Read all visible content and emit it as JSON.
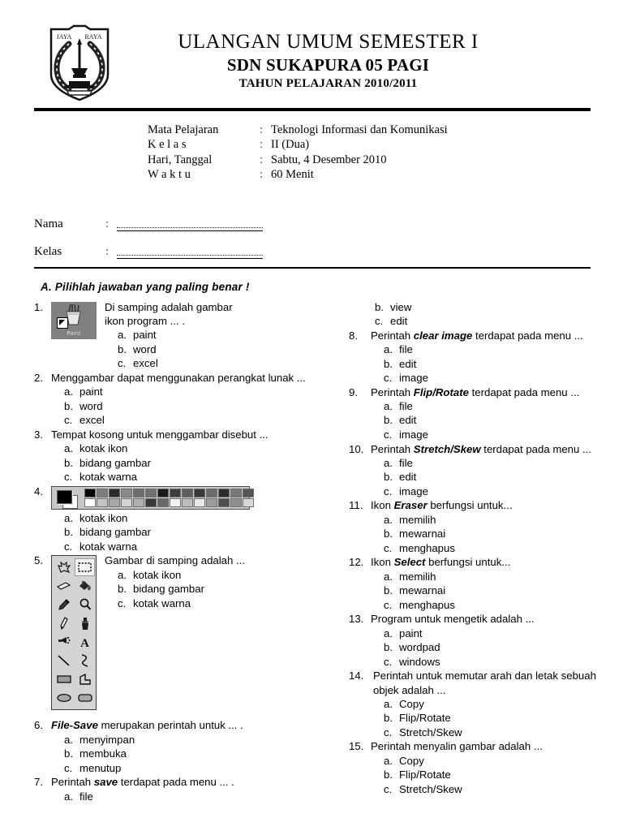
{
  "header": {
    "logo_text_left": "JAYA",
    "logo_text_right": "RAYA",
    "title_line1": "ULANGAN UMUM SEMESTER I",
    "title_line2": "SDN SUKAPURA 05 PAGI",
    "title_line3": "TAHUN PELAJARAN 2010/2011"
  },
  "info": [
    {
      "label": "Mata Pelajaran",
      "colon": ":",
      "value": "Teknologi Informasi dan Komunikasi"
    },
    {
      "label": "K e l a s",
      "colon": ":",
      "value": "II (Dua)"
    },
    {
      "label": "Hari, Tanggal",
      "colon": ":",
      "value": "Sabtu, 4 Desember 2010"
    },
    {
      "label": "W a k t u",
      "colon": ":",
      "value": "60 Menit"
    }
  ],
  "fields": [
    {
      "label": "Nama",
      "colon": ":",
      "value": ""
    },
    {
      "label": "Kelas",
      "colon": ":",
      "value": ""
    }
  ],
  "section_a": {
    "heading": "A. Pilihlah jawaban yang paling benar !"
  },
  "questions": {
    "q1": {
      "num": "1.",
      "figure": "paint-desktop-icon",
      "icon_label": "Paint",
      "text_line1": "Di samping adalah gambar",
      "text_line2": "ikon program ... .",
      "options": [
        {
          "key": "a.",
          "val": "paint"
        },
        {
          "key": "b.",
          "val": "word"
        },
        {
          "key": "c.",
          "val": "excel"
        }
      ]
    },
    "q2": {
      "num": "2.",
      "text": "Menggambar dapat menggunakan perangkat lunak ...",
      "options": [
        {
          "key": "a.",
          "val": "paint"
        },
        {
          "key": "b.",
          "val": "word"
        },
        {
          "key": "c.",
          "val": "excel"
        }
      ]
    },
    "q3": {
      "num": "3.",
      "text": "Tempat kosong untuk menggambar disebut ...",
      "options": [
        {
          "key": "a.",
          "val": "kotak ikon"
        },
        {
          "key": "b.",
          "val": "bidang gambar"
        },
        {
          "key": "c.",
          "val": "kotak warna"
        }
      ]
    },
    "q4": {
      "num": "4.",
      "figure": "paint-color-box",
      "options": [
        {
          "key": "a.",
          "val": "kotak ikon"
        },
        {
          "key": "b.",
          "val": "bidang gambar"
        },
        {
          "key": "c.",
          "val": "kotak warna"
        }
      ]
    },
    "q5": {
      "num": "5.",
      "figure": "paint-toolbox",
      "text": "Gambar di samping adalah ...",
      "options": [
        {
          "key": "a.",
          "val": "kotak ikon"
        },
        {
          "key": "b.",
          "val": "bidang gambar"
        },
        {
          "key": "c.",
          "val": "kotak warna"
        }
      ]
    },
    "q6": {
      "num": "6.",
      "bold": "File-Save",
      "text_after": " merupakan perintah untuk ... .",
      "options": [
        {
          "key": "a.",
          "val": "menyimpan"
        },
        {
          "key": "b.",
          "val": "membuka"
        },
        {
          "key": "c.",
          "val": "menutup"
        }
      ]
    },
    "q7": {
      "num": "7.",
      "text_before": "Perintah ",
      "bold": "save",
      "text_after": " terdapat pada menu ... .",
      "options": [
        {
          "key": "a.",
          "val": "file"
        },
        {
          "key": "b.",
          "val": "view"
        },
        {
          "key": "c.",
          "val": "edit"
        }
      ]
    },
    "q8": {
      "num": "8.",
      "text_before": "Perintah ",
      "bold": "clear image",
      "text_after": " terdapat pada menu ...",
      "options": [
        {
          "key": "a.",
          "val": "file"
        },
        {
          "key": "b.",
          "val": "edit"
        },
        {
          "key": "c.",
          "val": "image"
        }
      ]
    },
    "q9": {
      "num": "9.",
      "text_before": "Perintah ",
      "bold": "Flip/Rotate",
      "text_after": " terdapat pada menu ...",
      "options": [
        {
          "key": "a.",
          "val": "file"
        },
        {
          "key": "b.",
          "val": "edit"
        },
        {
          "key": "c.",
          "val": "image"
        }
      ]
    },
    "q10": {
      "num": "10.",
      "text_before": "Perintah ",
      "bold": "Stretch/Skew",
      "text_after": " terdapat pada menu ...",
      "options": [
        {
          "key": "a.",
          "val": "file"
        },
        {
          "key": "b.",
          "val": "edit"
        },
        {
          "key": "c.",
          "val": "image"
        }
      ]
    },
    "q11": {
      "num": "11.",
      "text_before": "Ikon ",
      "bold": "Eraser",
      "text_after": "  berfungsi untuk...",
      "options": [
        {
          "key": "a.",
          "val": "memilih"
        },
        {
          "key": "b.",
          "val": "mewarnai"
        },
        {
          "key": "c.",
          "val": "menghapus"
        }
      ]
    },
    "q12": {
      "num": "12.",
      "text_before": "Ikon ",
      "bold": "Select",
      "text_after": "  berfungsi untuk...",
      "options": [
        {
          "key": "a.",
          "val": "memilih"
        },
        {
          "key": "b.",
          "val": "mewarnai"
        },
        {
          "key": "c.",
          "val": "menghapus"
        }
      ]
    },
    "q13": {
      "num": "13.",
      "text": "Program untuk mengetik adalah ...",
      "options": [
        {
          "key": "a.",
          "val": "paint"
        },
        {
          "key": "b.",
          "val": "wordpad"
        },
        {
          "key": "c.",
          "val": "windows"
        }
      ]
    },
    "q14": {
      "num": "14.",
      "text": "Perintah untuk memutar arah dan letak sebuah objek  adalah ...",
      "options": [
        {
          "key": "a.",
          "val": "Copy"
        },
        {
          "key": "b.",
          "val": "Flip/Rotate"
        },
        {
          "key": "c.",
          "val": " Stretch/Skew"
        }
      ]
    },
    "q15": {
      "num": "15.",
      "text": "Perintah menyalin gambar adalah ...",
      "options": [
        {
          "key": "a.",
          "val": "Copy"
        },
        {
          "key": "b.",
          "val": "Flip/Rotate"
        },
        {
          "key": "c.",
          "val": " Stretch/Skew"
        }
      ]
    }
  },
  "palette": {
    "row1": [
      "#000000",
      "#7d7d7d",
      "#2b2b2b",
      "#8a8a8a",
      "#6e6e6e",
      "#707070",
      "#1a1a1a",
      "#3d3d3d",
      "#5c5c5c",
      "#383838",
      "#6b6b6b",
      "#2e2e2e",
      "#787878",
      "#555555"
    ],
    "row2": [
      "#ffffff",
      "#c4c4c4",
      "#a8a8a8",
      "#d4d4d4",
      "#b0b0b0",
      "#3a3a3a",
      "#6a6a6a",
      "#f2f2f2",
      "#bdbdbd",
      "#e8e8e8",
      "#9c9c9c",
      "#4e4e4e",
      "#8f8f8f",
      "#d8d8d8"
    ]
  },
  "toolbox": {
    "tools": [
      {
        "name": "free-form-select-icon",
        "selected": false
      },
      {
        "name": "rectangular-select-icon",
        "selected": true
      },
      {
        "name": "eraser-icon",
        "selected": false
      },
      {
        "name": "fill-with-color-icon",
        "selected": false
      },
      {
        "name": "pick-color-icon",
        "selected": false
      },
      {
        "name": "magnifier-icon",
        "selected": false
      },
      {
        "name": "pencil-icon",
        "selected": false
      },
      {
        "name": "brush-icon",
        "selected": false
      },
      {
        "name": "airbrush-icon",
        "selected": false
      },
      {
        "name": "text-tool-icon",
        "selected": false
      },
      {
        "name": "line-icon",
        "selected": false
      },
      {
        "name": "curve-icon",
        "selected": false
      },
      {
        "name": "rectangle-icon",
        "selected": false
      },
      {
        "name": "polygon-icon",
        "selected": false
      },
      {
        "name": "ellipse-icon",
        "selected": false
      },
      {
        "name": "rounded-rectangle-icon",
        "selected": false
      }
    ]
  }
}
